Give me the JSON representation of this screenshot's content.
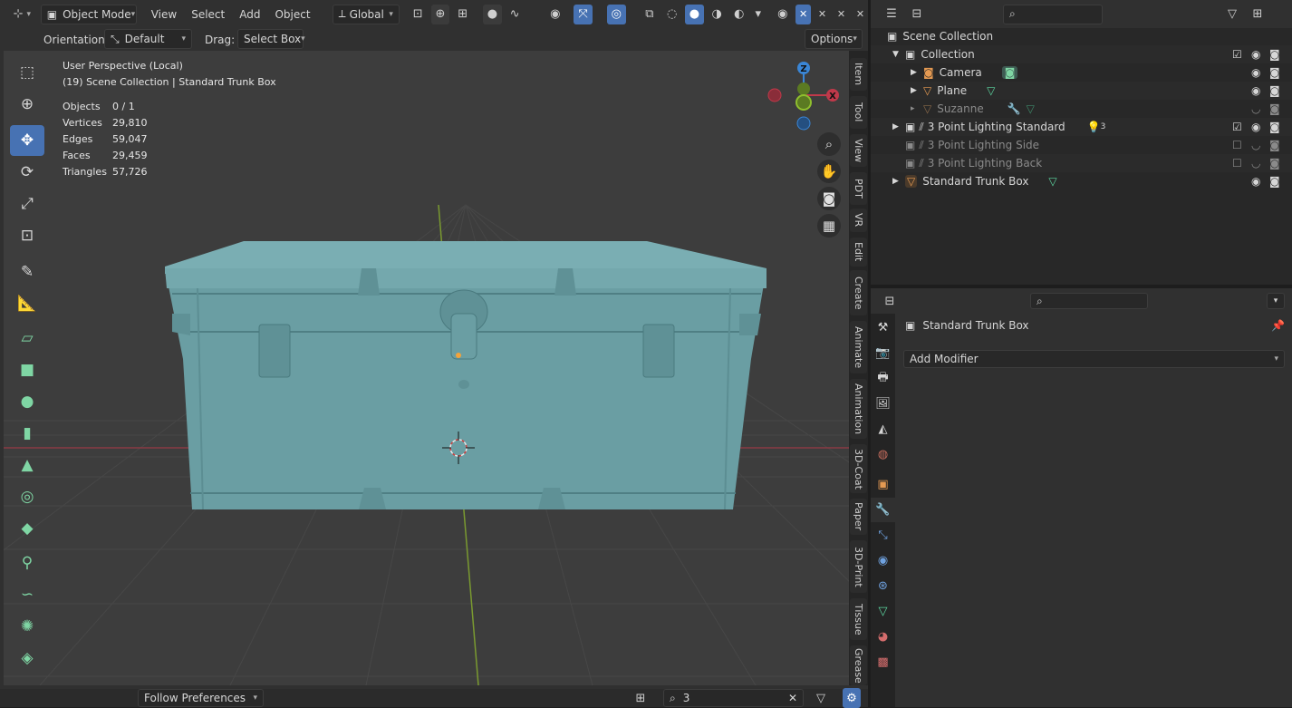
{
  "header": {
    "mode": "Object Mode",
    "menus": [
      "View",
      "Select",
      "Add",
      "Object"
    ],
    "transform_orientation": "Global"
  },
  "tool_settings": {
    "orientation_label": "Orientation:",
    "orientation_value": "Default",
    "drag_label": "Drag:",
    "drag_value": "Select Box",
    "options_label": "Options"
  },
  "overlay": {
    "perspective": "User Perspective (Local)",
    "collection_path": "(19) Scene Collection | Standard Trunk Box",
    "stats": [
      {
        "label": "Objects",
        "value": "0 / 1"
      },
      {
        "label": "Vertices",
        "value": "29,810"
      },
      {
        "label": "Edges",
        "value": "59,047"
      },
      {
        "label": "Faces",
        "value": "29,459"
      },
      {
        "label": "Triangles",
        "value": "57,726"
      }
    ]
  },
  "gizmo": {
    "z": "Z",
    "x": "X"
  },
  "side_tabs": [
    "Item",
    "Tool",
    "View",
    "PDT",
    "VR",
    "Edit",
    "Create",
    "Animate",
    "Animation",
    "3D-Coat",
    "Paper",
    "3D-Print",
    "Tissue",
    "Grease"
  ],
  "bottom": {
    "follow": "Follow Preferences",
    "search_value": "3"
  },
  "outliner": {
    "scene_collection": "Scene Collection",
    "items": [
      {
        "name": "Collection"
      },
      {
        "name": "Camera"
      },
      {
        "name": "Plane"
      },
      {
        "name": "Suzanne"
      },
      {
        "name": "3 Point Lighting Standard",
        "count": "3"
      },
      {
        "name": "3 Point Lighting Side"
      },
      {
        "name": "3 Point Lighting Back"
      },
      {
        "name": "Standard Trunk Box"
      }
    ]
  },
  "properties": {
    "object_name": "Standard Trunk Box",
    "add_modifier": "Add Modifier"
  },
  "colors": {
    "accent": "#4772b3",
    "axis_x": "#c0394a",
    "axis_y": "#8fbf2e",
    "axis_z": "#3a86d6",
    "model": "#6a9ea3"
  }
}
